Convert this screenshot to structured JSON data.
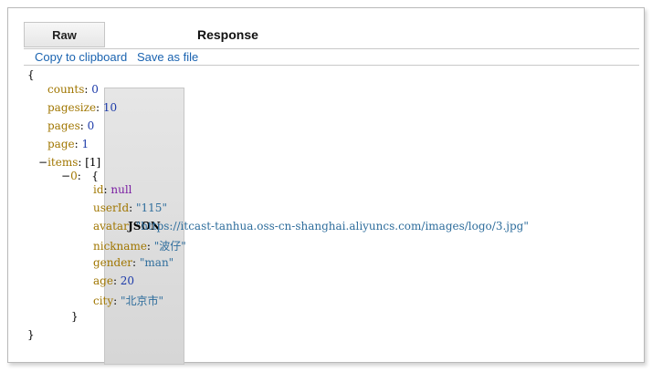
{
  "tabs": {
    "raw": "Raw",
    "json": "JSON",
    "title": "Response"
  },
  "toolbar": {
    "copy": "Copy to clipboard",
    "save": "Save as file"
  },
  "json": {
    "open_brace": "{",
    "close_brace": "}",
    "counts": {
      "key": "counts",
      "value": "0"
    },
    "pagesize": {
      "key": "pagesize",
      "value": "10"
    },
    "pages": {
      "key": "pages",
      "value": "0"
    },
    "page": {
      "key": "page",
      "value": "1"
    },
    "items": {
      "toggle": "−",
      "key": "items",
      "value": "[1]"
    },
    "item0": {
      "toggle": "−",
      "key": "0",
      "open": "{",
      "close": "}"
    },
    "id": {
      "key": "id",
      "value": "null"
    },
    "userId": {
      "key": "userId",
      "value": "\"115\""
    },
    "avatar": {
      "key": "avatar",
      "value": "\"https://itcast-tanhua.oss-cn-shanghai.aliyuncs.com/images/logo/3.jpg\""
    },
    "nickname": {
      "key": "nickname",
      "value": "\"波仔\""
    },
    "gender": {
      "key": "gender",
      "value": "\"man\""
    },
    "age": {
      "key": "age",
      "value": "20"
    },
    "city": {
      "key": "city",
      "value": "\"北京市\""
    }
  }
}
